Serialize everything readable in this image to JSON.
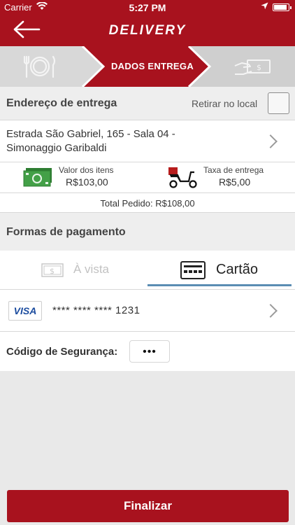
{
  "status_bar": {
    "carrier": "Carrier",
    "time": "5:27 PM"
  },
  "header": {
    "title": "DELIVERY"
  },
  "steps": {
    "active_label": "DADOS ENTREGA"
  },
  "address_section": {
    "label": "Endereço de entrega",
    "pickup_label": "Retirar no local",
    "pickup_checked": false
  },
  "address": {
    "line1": "Estrada São Gabriel, 165 - Sala 04 -",
    "line2": "Simonaggio Garibaldi"
  },
  "totals": {
    "items_label": "Valor dos itens",
    "items_value": "R$103,00",
    "delivery_label": "Taxa de entrega",
    "delivery_value": "R$5,00",
    "total_label": "Total Pedido:",
    "total_value": "R$108,00"
  },
  "payment": {
    "label": "Formas de pagamento",
    "tabs": [
      {
        "label": "À vista",
        "active": false
      },
      {
        "label": "Cartão",
        "active": true
      }
    ]
  },
  "card": {
    "brand": "VISA",
    "number": "**** **** **** 1231"
  },
  "security": {
    "label": "Código de Segurança:",
    "value": "•••"
  },
  "footer": {
    "button_label": "Finalizar"
  },
  "colors": {
    "brand_red": "#a8121e",
    "tab_underline": "#5b8db3",
    "background": "#e9e9e9"
  }
}
